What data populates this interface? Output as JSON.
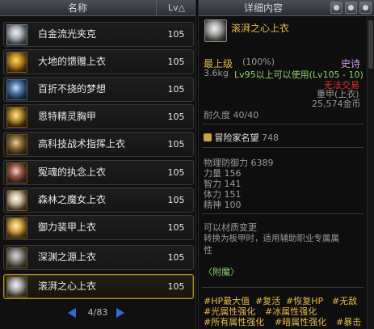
{
  "left": {
    "header_name": "名称",
    "header_lv": "Lv△",
    "items": [
      {
        "name": "白金流光夹克",
        "lv": "105"
      },
      {
        "name": "大地的馈赠上衣",
        "lv": "105"
      },
      {
        "name": "百折不挠的梦想",
        "lv": "105"
      },
      {
        "name": "恩特精灵胸甲",
        "lv": "105"
      },
      {
        "name": "高科技战术指挥上衣",
        "lv": "105"
      },
      {
        "name": "冤魂的执念上衣",
        "lv": "105"
      },
      {
        "name": "森林之魔女上衣",
        "lv": "105"
      },
      {
        "name": "御力装甲上衣",
        "lv": "105"
      },
      {
        "name": "深渊之源上衣",
        "lv": "105"
      },
      {
        "name": "滚湃之心上衣",
        "lv": "105"
      }
    ],
    "page": "4/83"
  },
  "detail": {
    "header": "详细内容",
    "item_name": "滚湃之心上衣",
    "grade": "最上级",
    "grade_pct": "(100%)",
    "rarity": "史诗",
    "weight": "3.6kg",
    "level_req": "Lv95以上可以使用(Lv105 - 10)",
    "trade": "无法交易",
    "type": "重甲(上衣)",
    "price": "25,574金币",
    "durability": "耐久度 40/40",
    "fame_label": "冒险家名望",
    "fame_value": "748",
    "phys_def": "物理防御力 6389",
    "str": "力量 156",
    "int": "智力 141",
    "vit": "体力 151",
    "spi": "精神 100",
    "note1": "可以材质变更",
    "note2": "转换为板甲时，适用辅助职业专属属",
    "note3": "性",
    "enchant": "〈附魔〉",
    "tags_row1": [
      "#HP最大值",
      "#复活",
      "#恢复HP",
      "#无敌"
    ],
    "tags_row2": [
      "#光属性强化",
      "#冰属性强化"
    ],
    "tags_row3": [
      "#所有属性强化",
      "#暗属性强化",
      "#暴击"
    ]
  }
}
